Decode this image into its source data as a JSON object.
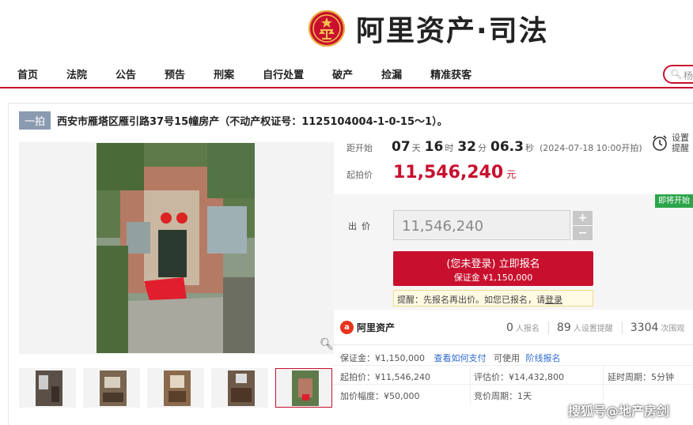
{
  "header": {
    "logo_text": "阿里资产·司法"
  },
  "nav": {
    "items": [
      "首页",
      "法院",
      "公告",
      "预告",
      "刑案",
      "自行处置",
      "破产",
      "捡漏",
      "精准获客"
    ],
    "search_placeholder": "杨"
  },
  "listing": {
    "round_badge": "一拍",
    "title": "西安市雁塔区雁引路37号15幢房产（不动产权证号：1125104004-1-0-15～1）。"
  },
  "countdown": {
    "label": "距开始",
    "days": "07",
    "days_unit": "天",
    "hours": "16",
    "hours_unit": "时",
    "minutes": "32",
    "minutes_unit": "分",
    "seconds": "06.3",
    "seconds_unit": "秒",
    "start_time": "(2024-07-18 10:00开拍)"
  },
  "reminder": {
    "line1": "设置",
    "line2": "提醒"
  },
  "start_price": {
    "label": "起拍价",
    "value": "11,546,240",
    "unit": "元"
  },
  "bid": {
    "status_tag": "即将开始",
    "label": "出价",
    "input_value": "11,546,240",
    "plus": "+",
    "minus": "−",
    "signup_label": "(您未登录) 立即报名",
    "deposit_label": "保证金 ¥1,150,000",
    "tip_prefix": "提醒：先报名再出价。如您已报名，请",
    "tip_link": "登录"
  },
  "stats": {
    "brand": "阿里资产",
    "signups_count": "0",
    "signups_label": "人报名",
    "reminders_count": "89",
    "reminders_label": "人设置提醒",
    "views_count": "3304",
    "views_label": "次围观"
  },
  "details": {
    "deposit": "保证金：¥1,150,000",
    "how_to_pay": "查看如何支付",
    "available": "可使用",
    "pay_later": "阶线报名",
    "start_price": "起拍价：¥11,546,240",
    "appraisal": "评估价：¥14,432,800",
    "extension": "延时周期：5分钟",
    "increment": "加价幅度：¥50,000",
    "bid_period": "竞价周期：1天"
  },
  "watermark": "搜狐号@地产房剑",
  "colors": {
    "brand_red": "#c8102e",
    "link_blue": "#2f6ad1",
    "status_green": "#2aa54a"
  }
}
